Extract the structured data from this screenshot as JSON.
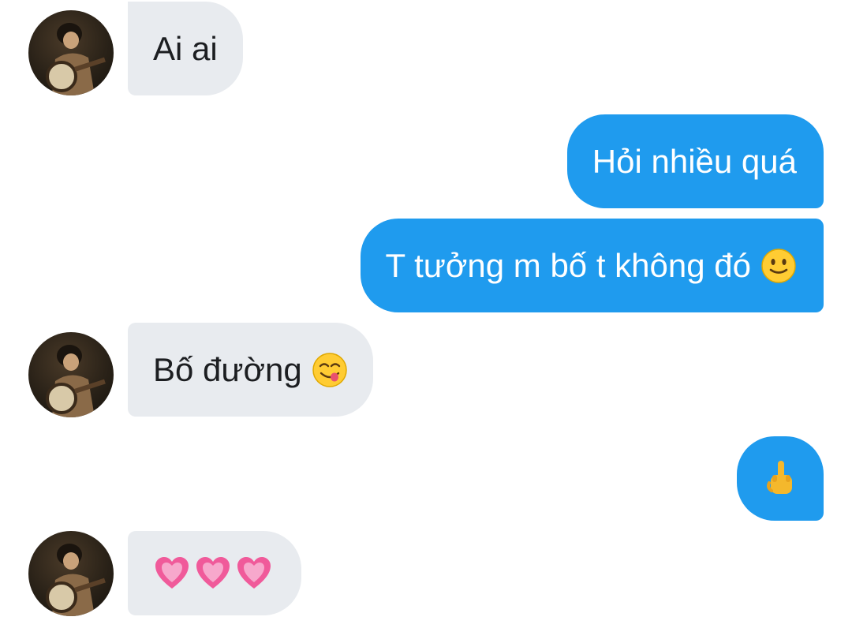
{
  "conversation": {
    "messages": [
      {
        "sender": "other",
        "text": "Ai ai"
      },
      {
        "sender": "me",
        "text": "Hỏi nhiều quá"
      },
      {
        "sender": "me",
        "text": "T tưởng m bố t không đó",
        "emoji": "slightly-smiling-face"
      },
      {
        "sender": "other",
        "text": "Bố đường",
        "emoji": "face-savoring-food"
      },
      {
        "sender": "me",
        "text": "🖕",
        "emoji": "middle-finger"
      },
      {
        "sender": "other",
        "text": "💗💗💗",
        "emoji": "growing-heart"
      }
    ]
  },
  "colors": {
    "incoming_bubble": "#e8ebef",
    "outgoing_bubble": "#1f9bee",
    "incoming_text": "#1c1e21",
    "outgoing_text": "#ffffff"
  }
}
